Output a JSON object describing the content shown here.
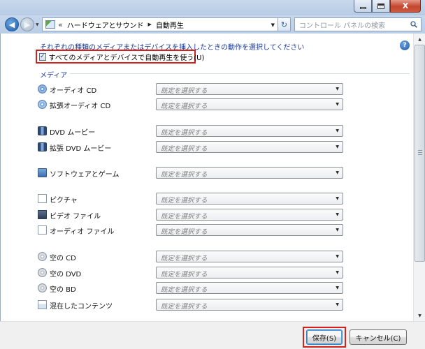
{
  "window": {
    "controls": {
      "minimize": "minimize",
      "maximize": "maximize",
      "close_label": "X"
    }
  },
  "nav": {
    "breadcrumb_prefix": "«",
    "breadcrumbs": [
      "ハードウェアとサウンド",
      "自動再生"
    ],
    "search_placeholder": "コントロール パネルの検索"
  },
  "content": {
    "intro": "それぞれの種類のメディアまたはデバイスを挿入したときの動作を選択してください",
    "help_label": "?",
    "autoplay_checkbox": {
      "label": "すべてのメディアとデバイスで自動再生を使う(U)",
      "checked": true,
      "mark": "✓"
    },
    "section_title": "メディア",
    "default_option": "既定を選択する",
    "media": [
      {
        "label": "オーディオ CD",
        "icon": "audio-cd-icon",
        "value": "既定を選択する"
      },
      {
        "label": "拡張オーディオ CD",
        "icon": "enhanced-audio-cd-icon",
        "value": "既定を選択する"
      },
      {
        "label": "DVD ムービー",
        "icon": "dvd-movie-icon",
        "value": "既定を選択する"
      },
      {
        "label": "拡張 DVD ムービー",
        "icon": "enhanced-dvd-movie-icon",
        "value": "既定を選択する"
      },
      {
        "label": "ソフトウェアとゲーム",
        "icon": "software-games-icon",
        "value": "既定を選択する"
      },
      {
        "label": "ピクチャ",
        "icon": "pictures-icon",
        "value": "既定を選択する"
      },
      {
        "label": "ビデオ ファイル",
        "icon": "video-files-icon",
        "value": "既定を選択する"
      },
      {
        "label": "オーディオ ファイル",
        "icon": "audio-files-icon",
        "value": "既定を選択する"
      },
      {
        "label": "空の CD",
        "icon": "blank-cd-icon",
        "value": "既定を選択する"
      },
      {
        "label": "空の DVD",
        "icon": "blank-dvd-icon",
        "value": "既定を選択する"
      },
      {
        "label": "空の BD",
        "icon": "blank-bd-icon",
        "value": "既定を選択する"
      },
      {
        "label": "混在したコンテンツ",
        "icon": "mixed-content-icon",
        "value": "既定を選択する"
      }
    ]
  },
  "footer": {
    "save_label": "保存(S)",
    "cancel_label": "キャンセル(C)"
  },
  "colors": {
    "link_blue": "#1a3c9a",
    "highlight_red": "#d5211d",
    "titlebar": "#c9d9ec"
  }
}
